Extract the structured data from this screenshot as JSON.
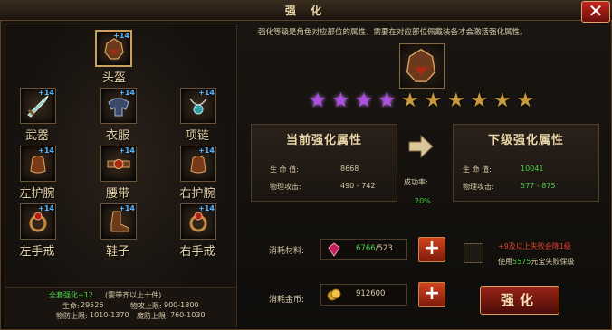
{
  "window": {
    "title": "强 化",
    "close_icon": "close-x-icon"
  },
  "equipment": {
    "slots": [
      {
        "label": "头盔",
        "level": "+14",
        "selected": true,
        "icon": "helmet-icon"
      },
      {
        "label": "武器",
        "level": "+14",
        "selected": false,
        "icon": "sword-icon"
      },
      {
        "label": "衣服",
        "level": "+14",
        "selected": false,
        "icon": "armor-icon"
      },
      {
        "label": "项链",
        "level": "+14",
        "selected": false,
        "icon": "necklace-icon"
      },
      {
        "label": "左护腕",
        "level": "+14",
        "selected": false,
        "icon": "bracer-icon"
      },
      {
        "label": "腰带",
        "level": "+14",
        "selected": false,
        "icon": "belt-icon"
      },
      {
        "label": "右护腕",
        "level": "+14",
        "selected": false,
        "icon": "bracer-icon"
      },
      {
        "label": "左手戒",
        "level": "+14",
        "selected": false,
        "icon": "ring-icon"
      },
      {
        "label": "鞋子",
        "level": "+14",
        "selected": false,
        "icon": "boots-icon"
      },
      {
        "label": "右手戒",
        "level": "+14",
        "selected": false,
        "icon": "ring-icon"
      }
    ],
    "bonus": {
      "title": "全套强化+12",
      "requirement": "(需带齐以上十件)",
      "hp_label": "生命:",
      "hp_value": "29526",
      "patk_label": "物攻上限:",
      "patk_value": "900-1800",
      "pdef_label": "物防上限:",
      "pdef_value": "1010-1370",
      "mdef_label": "魔防上限:",
      "mdef_value": "760-1030"
    }
  },
  "enhance": {
    "description": "强化等级是角色对应部位的属性，需要在对应部位佩戴装备才会激活强化属性。",
    "stars_total": 10,
    "stars_filled": 4,
    "current": {
      "title": "当前强化属性",
      "hp_label": "生 命 值:",
      "hp_value": "8668",
      "atk_label": "物理攻击:",
      "atk_value": "490 - 742"
    },
    "next": {
      "title": "下级强化属性",
      "hp_label": "生 命 值:",
      "hp_value": "10041",
      "atk_label": "物理攻击:",
      "atk_value": "577 - 875"
    },
    "success_rate_label": "成功率:",
    "success_rate_value": "20%",
    "material": {
      "label": "消耗材料:",
      "have": "6766",
      "need": "/523"
    },
    "gold": {
      "label": "消耗金币:",
      "value": "912600"
    },
    "protect_note_1": "+9及以上失败会降1级",
    "protect_note_2_pre": "使用",
    "protect_note_2_num": "5575",
    "protect_note_2_post": "元宝失败保级",
    "enhance_button": "强化"
  },
  "colors": {
    "accent_gold": "#c9a25f",
    "success_green": "#47d14a",
    "warn_red": "#e0412e",
    "star_filled": "#b04fe6",
    "star_empty": "#c99a3c"
  }
}
